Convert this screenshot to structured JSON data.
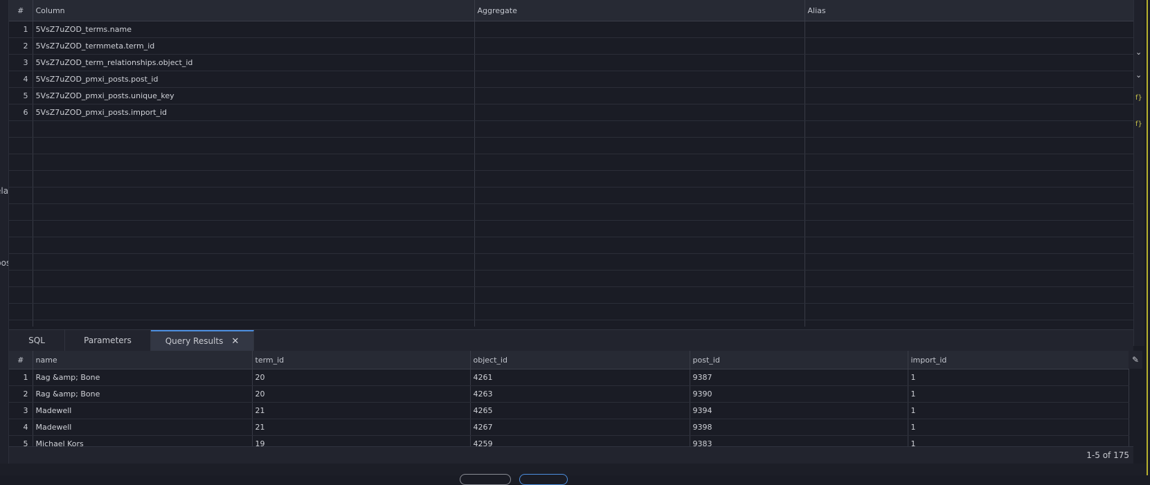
{
  "side_fragments": {
    "a": "ela",
    "b": "pos"
  },
  "columns_grid": {
    "headers": {
      "num": "#",
      "column": "Column",
      "aggregate": "Aggregate",
      "alias": "Alias"
    },
    "rows": [
      {
        "num": "1",
        "column": "5VsZ7uZOD_terms.name",
        "aggregate": "",
        "alias": ""
      },
      {
        "num": "2",
        "column": "5VsZ7uZOD_termmeta.term_id",
        "aggregate": "",
        "alias": ""
      },
      {
        "num": "3",
        "column": "5VsZ7uZOD_term_relationships.object_id",
        "aggregate": "",
        "alias": ""
      },
      {
        "num": "4",
        "column": "5VsZ7uZOD_pmxi_posts.post_id",
        "aggregate": "",
        "alias": ""
      },
      {
        "num": "5",
        "column": "5VsZ7uZOD_pmxi_posts.unique_key",
        "aggregate": "",
        "alias": ""
      },
      {
        "num": "6",
        "column": "5VsZ7uZOD_pmxi_posts.import_id",
        "aggregate": "",
        "alias": ""
      }
    ]
  },
  "tabs": {
    "sql": "SQL",
    "parameters": "Parameters",
    "query_results": "Query Results",
    "close_glyph": "✕"
  },
  "results": {
    "headers": {
      "num": "#",
      "name": "name",
      "term_id": "term_id",
      "object_id": "object_id",
      "post_id": "post_id",
      "import_id": "import_id"
    },
    "rows": [
      {
        "num": "1",
        "name": "Rag &amp; Bone",
        "term_id": "20",
        "object_id": "4261",
        "post_id": "9387",
        "import_id": "1"
      },
      {
        "num": "2",
        "name": "Rag &amp; Bone",
        "term_id": "20",
        "object_id": "4263",
        "post_id": "9390",
        "import_id": "1"
      },
      {
        "num": "3",
        "name": "Madewell",
        "term_id": "21",
        "object_id": "4265",
        "post_id": "9394",
        "import_id": "1"
      },
      {
        "num": "4",
        "name": "Madewell",
        "term_id": "21",
        "object_id": "4267",
        "post_id": "9398",
        "import_id": "1"
      },
      {
        "num": "5",
        "name": "Michael Kors",
        "term_id": "19",
        "object_id": "4259",
        "post_id": "9383",
        "import_id": "1"
      }
    ],
    "count": "1-5 of 175"
  },
  "icons": {
    "chevron_down": "⌄",
    "function": "f}",
    "edit": "✎"
  },
  "colors": {
    "accent": "#4c8fe0",
    "edge": "#b8b12d",
    "background": "#1a1c25"
  }
}
